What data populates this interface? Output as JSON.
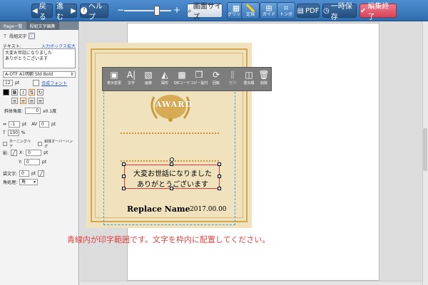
{
  "toolbar": {
    "back": "戻る",
    "forward": "進む",
    "help": "ヘルプ",
    "zoom_minus": "−",
    "zoom_plus": "+",
    "zoom_level": 0.7,
    "screen_size": "画面サイズ",
    "grid": "グリッド",
    "ruler": "定規",
    "guide": "ガイド",
    "trimbo": "トンボ",
    "pdf": "PDF",
    "temp_save": "一時保存",
    "finish": "編集終了"
  },
  "panel": {
    "tabs": [
      "Page一覧",
      "段組文字編集"
    ],
    "section_label": "段組文字",
    "text_label": "テキスト:",
    "input_box_link": "入力ボックス拡大",
    "text_value_line1": "大変お世話になりました",
    "text_value_line2": "ありがとうございます",
    "font_name": "A-OTF A1明朝 Std Bold",
    "font_size": "12",
    "pt_unit": "pt",
    "composite_font": "合成フォント",
    "slant_label": "斜体角度:",
    "slant_value": "0",
    "slant_unit": "x0.1度",
    "tracking_value": "-1",
    "tracking_unit": "pt",
    "kerning_value": "0",
    "kerning_unit": "pt",
    "scale_value": "100",
    "scale_unit": "%",
    "kerning_pair": "カーニングペア",
    "italic_overhang": "斜体オーバーハング",
    "shadow_label": "影:",
    "shadow_x_label": "X:",
    "shadow_x": "0",
    "shadow_y_label": "Y:",
    "shadow_y": "0",
    "outline_label": "袋文字:",
    "outline_value": "0",
    "corner_label": "角処理:",
    "corner_value": "角"
  },
  "float_toolbar": [
    "表示変更",
    "文字",
    "画像",
    "図形",
    "QRコード",
    "コピー貼付",
    "回転",
    "整列",
    "重ね順",
    "削除"
  ],
  "certificate": {
    "award": "AWARD",
    "message_line1": "大変お世話になりました",
    "message_line2": "ありがとうございます",
    "name": "Replace Name",
    "date": "2017.00.00"
  },
  "notice": "青線内が印字範囲です。文字を枠内に配置してください。"
}
